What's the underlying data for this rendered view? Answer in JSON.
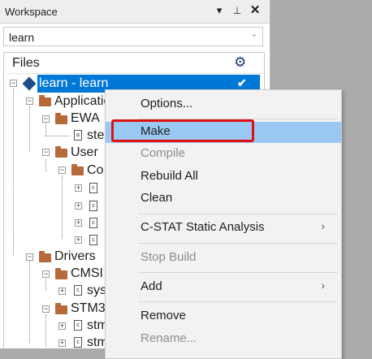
{
  "workspace": {
    "title": "Workspace",
    "pin_glyph": "▾",
    "pin2_glyph": "⊥",
    "close_glyph": "✕",
    "config_value": "learn",
    "files_header": "Files"
  },
  "tree": {
    "root": "learn - learn",
    "items": {
      "application": "Applicatio",
      "ewa": "EWA",
      "ste": "ste",
      "user": "User",
      "co": "Co",
      "drivers": "Drivers",
      "cmsis": "CMSI",
      "sys": "sys",
      "stm": "STM3",
      "stm_a": "stm",
      "stm_b": "stm"
    }
  },
  "menu": {
    "options": "Options...",
    "make": "Make",
    "compile": "Compile",
    "rebuild_all": "Rebuild All",
    "clean": "Clean",
    "cstat": "C-STAT Static Analysis",
    "stop_build": "Stop Build",
    "add": "Add",
    "remove": "Remove",
    "rename": "Rename..."
  },
  "colors": {
    "selection": "#0078d7",
    "menu_highlight": "#99c9f2",
    "annotation_box": "#e01010",
    "folder": "#b66a3a"
  }
}
